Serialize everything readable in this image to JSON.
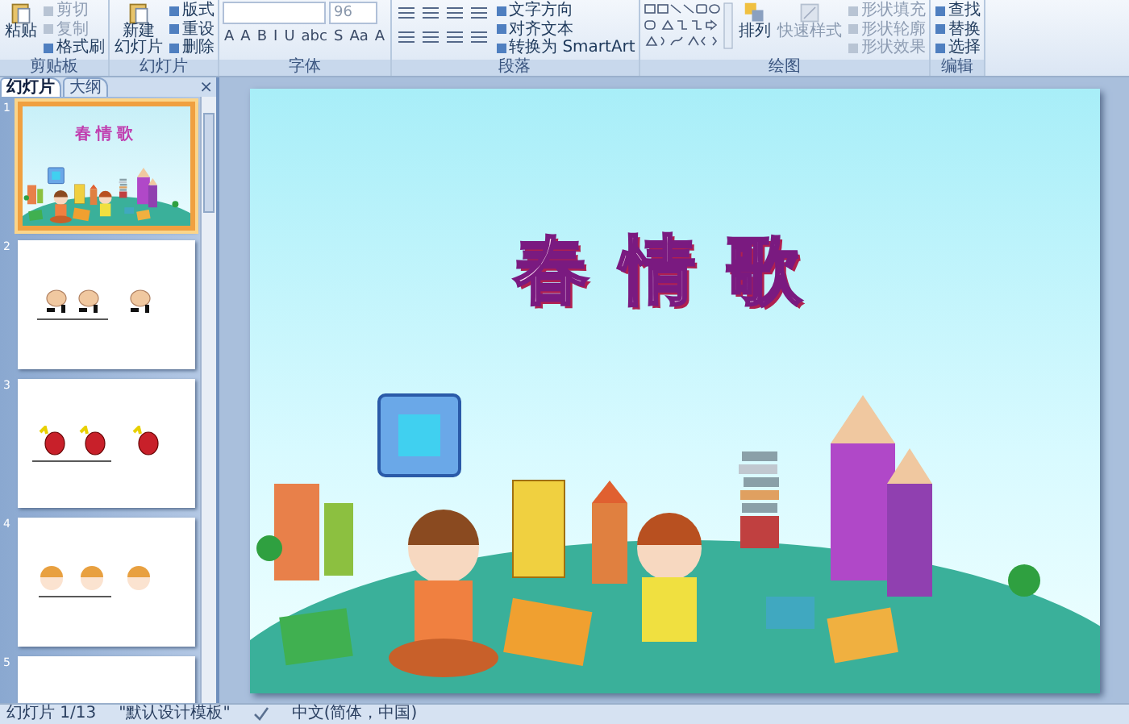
{
  "ribbon": {
    "groups": [
      {
        "kind": "clipboard",
        "label": "剪贴板",
        "big": "粘贴",
        "items": [
          {
            "label": "剪切",
            "disabled": true
          },
          {
            "label": "复制",
            "disabled": true
          },
          {
            "label": "格式刷",
            "disabled": false
          }
        ]
      },
      {
        "kind": "slides",
        "label": "幻灯片",
        "big_lines": [
          "新建",
          "幻灯片"
        ],
        "items": [
          {
            "label": "版式",
            "disabled": false
          },
          {
            "label": "重设",
            "disabled": false
          },
          {
            "label": "删除",
            "disabled": false
          }
        ]
      },
      {
        "kind": "font",
        "label": "字体",
        "font_size": "96",
        "buttons": [
          "A",
          "A",
          "B",
          "I",
          "U",
          "abc",
          "S",
          "Aa",
          "A"
        ]
      },
      {
        "kind": "paragraph",
        "label": "段落",
        "items": [
          {
            "label": "文字方向",
            "disabled": false
          },
          {
            "label": "对齐文本",
            "disabled": false
          },
          {
            "label": "转换为 SmartArt",
            "disabled": false
          }
        ]
      },
      {
        "kind": "drawing",
        "label": "绘图",
        "big": "排列",
        "big2": "快速样式",
        "items": [
          {
            "label": "形状填充",
            "disabled": true
          },
          {
            "label": "形状轮廓",
            "disabled": true
          },
          {
            "label": "形状效果",
            "disabled": true
          }
        ]
      },
      {
        "kind": "editing",
        "label": "编辑",
        "items": [
          {
            "label": "查找",
            "disabled": false
          },
          {
            "label": "替换",
            "disabled": false
          },
          {
            "label": "选择",
            "disabled": false
          }
        ]
      }
    ]
  },
  "pane": {
    "tabs": [
      {
        "label": "幻灯片",
        "selected": true
      },
      {
        "label": "大纲",
        "selected": false
      }
    ],
    "close": "×",
    "slides": [
      {
        "number": "1",
        "kind": "title",
        "selected": true,
        "title": "春情歌"
      },
      {
        "number": "2",
        "kind": "hands",
        "selected": false
      },
      {
        "number": "3",
        "kind": "shoes",
        "selected": false
      },
      {
        "number": "4",
        "kind": "heads",
        "selected": false
      },
      {
        "number": "5",
        "kind": "blank",
        "selected": false
      }
    ]
  },
  "slide": {
    "title": "春情歌"
  },
  "status_bar": {
    "slide": "幻灯片 1/13",
    "theme": "\"默认设计模板\"",
    "language": "中文(简体，中国)"
  }
}
